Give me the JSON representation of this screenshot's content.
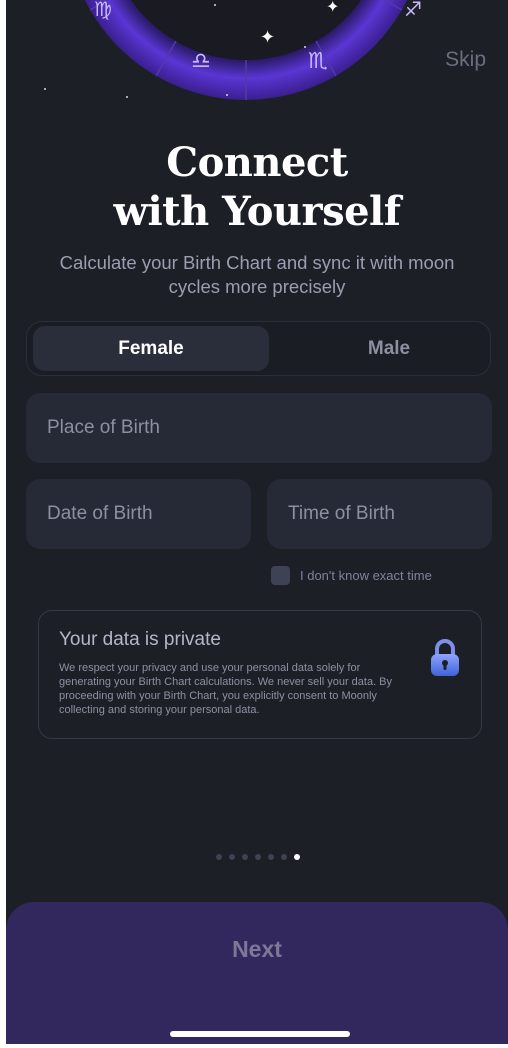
{
  "header": {
    "skip_label": "Skip"
  },
  "hero": {
    "title_line1": "Connect",
    "title_line2": "with Yourself",
    "subtitle": "Calculate your Birth Chart and sync it with moon cycles more precisely"
  },
  "gender": {
    "options": [
      "Female",
      "Male"
    ],
    "selected": "Female"
  },
  "form": {
    "place_placeholder": "Place of Birth",
    "date_placeholder": "Date of Birth",
    "time_placeholder": "Time of Birth",
    "unknown_time_label": "I don't know exact time",
    "unknown_time_checked": false
  },
  "privacy": {
    "title": "Your data is private",
    "body": "We respect your privacy and use your personal data solely for generating your Birth Chart calculations. We never sell your data. By proceeding with your Birth Chart, you explicitly consent to Moonly collecting and storing your personal data.",
    "icon": "lock-icon"
  },
  "pager": {
    "total": 7,
    "current": 7
  },
  "footer": {
    "next_label": "Next"
  },
  "colors": {
    "background": "#1d1f27",
    "accent": "#5b3fd6",
    "panel": "#33285e"
  }
}
